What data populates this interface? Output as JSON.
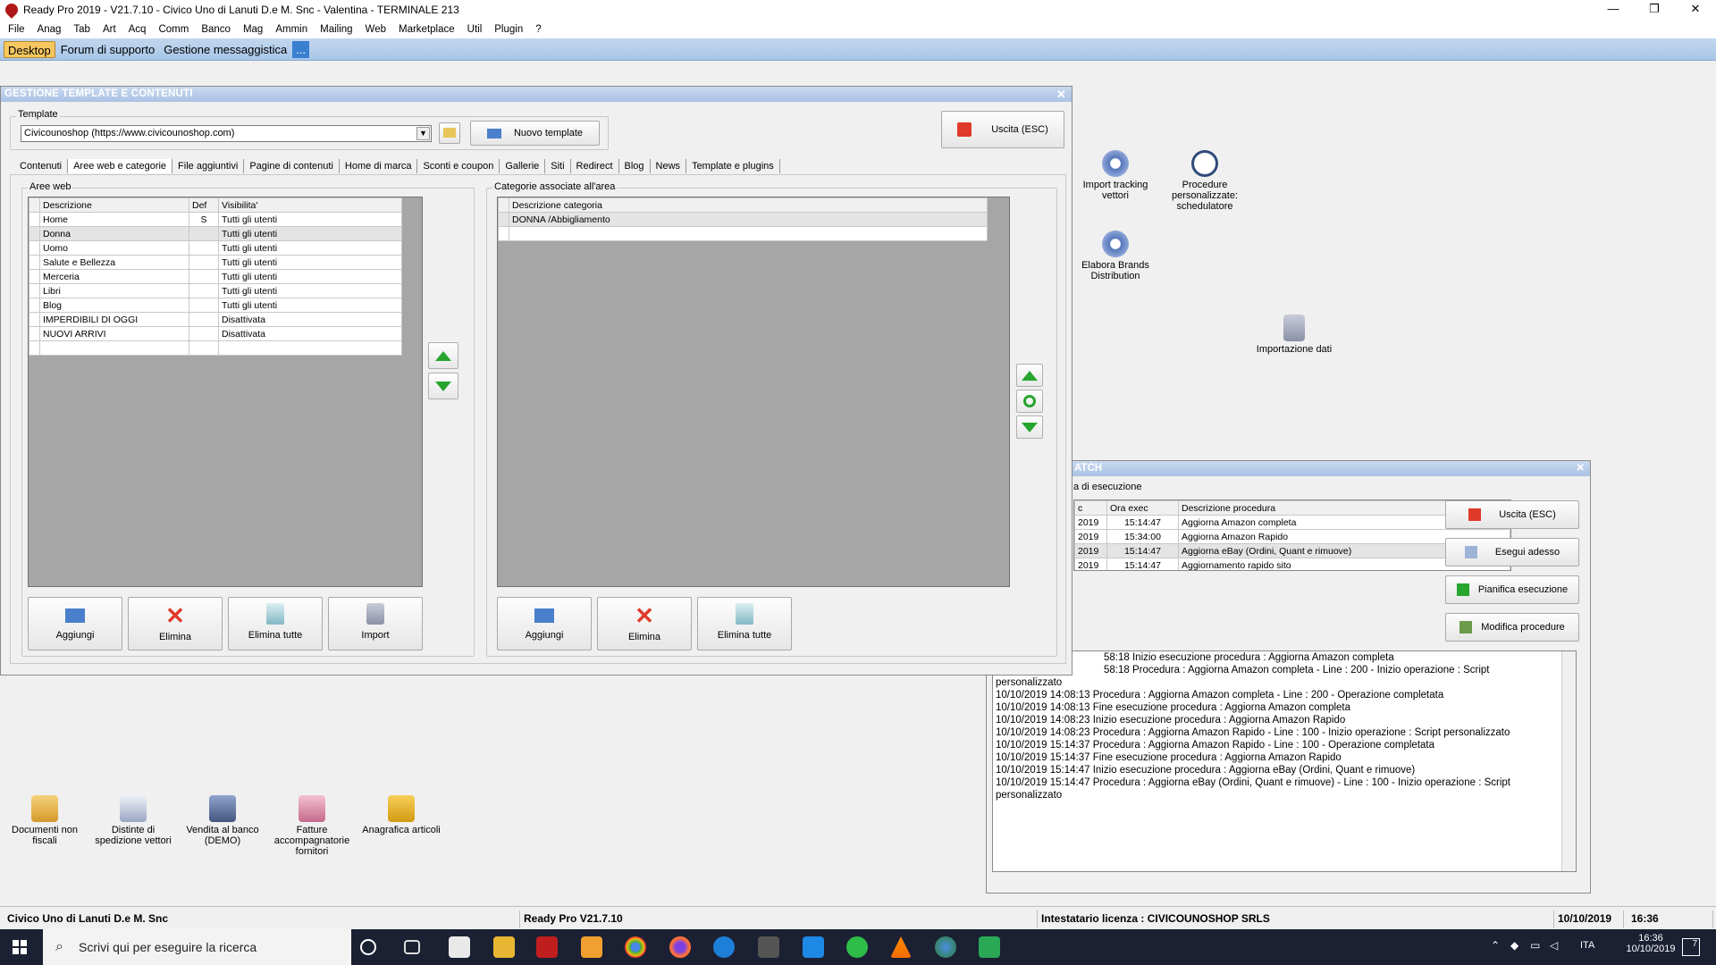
{
  "window": {
    "title": "Ready Pro 2019 - V21.7.10 - Civico Uno di Lanuti D.e M. Snc - Valentina - TERMINALE 213",
    "min": "—",
    "max": "❐",
    "close": "✕"
  },
  "menu": [
    "File",
    "Anag",
    "Tab",
    "Art",
    "Acq",
    "Comm",
    "Banco",
    "Mag",
    "Ammin",
    "Mailing",
    "Web",
    "Marketplace",
    "Util",
    "Plugin",
    "?"
  ],
  "tabs": [
    "Desktop",
    "Forum di supporto",
    "Gestione messaggistica",
    "..."
  ],
  "desktop_icons": {
    "import_tracking": "Import tracking vettori",
    "procedure": "Procedure personalizzate: schedulatore",
    "elabora": "Elabora Brands Distribution",
    "importazione": "Importazione dati",
    "documenti": "Documenti non fiscali",
    "distinte": "Distinte di spedizione vettori",
    "vendita": "Vendita al banco (DEMO)",
    "fatture": "Fatture accompagnatorie fornitori",
    "anagrafica": "Anagrafica articoli"
  },
  "dialog": {
    "title": "GESTIONE TEMPLATE E CONTENUTI",
    "close": "✕",
    "template_legend": "Template",
    "template_value": "Civicounoshop (https://www.civicounoshop.com)",
    "new_template": "Nuovo template",
    "exit": "Uscita (ESC)",
    "inner_tabs": [
      "Contenuti",
      "Aree web e categorie",
      "File aggiuntivi",
      "Pagine di contenuti",
      "Home di marca",
      "Sconti e coupon",
      "Gallerie",
      "Siti",
      "Redirect",
      "Blog",
      "News",
      "Template e plugins"
    ],
    "areas_legend": "Aree web",
    "areas_headers": [
      "Descrizione",
      "Def",
      "Visibilita'"
    ],
    "areas_rows": [
      [
        "Home",
        "S",
        "Tutti gli utenti"
      ],
      [
        "Donna",
        "",
        "Tutti gli utenti"
      ],
      [
        "Uomo",
        "",
        "Tutti gli utenti"
      ],
      [
        "Salute e Bellezza",
        "",
        "Tutti gli utenti"
      ],
      [
        "Merceria",
        "",
        "Tutti gli utenti"
      ],
      [
        "Libri",
        "",
        "Tutti gli utenti"
      ],
      [
        "Blog",
        "",
        "Tutti gli utenti"
      ],
      [
        "IMPERDIBILI DI OGGI",
        "",
        "Disattivata"
      ],
      [
        "NUOVI ARRIVI",
        "",
        "Disattivata"
      ],
      [
        "",
        "",
        ""
      ]
    ],
    "cat_legend": "Categorie associate all'area",
    "cat_header": "Descrizione categoria",
    "cat_rows": [
      "DONNA /Abbigliamento",
      ""
    ],
    "btn_add": "Aggiungi",
    "btn_del": "Elimina",
    "btn_del_all": "Elimina tutte",
    "btn_import": "Import"
  },
  "batch": {
    "title": "ATCH",
    "close": "✕",
    "subtitle": "a di esecuzione",
    "headers": [
      "c",
      "Ora exec",
      "Descrizione procedura"
    ],
    "rows": [
      [
        "2019",
        "15:14:47",
        "Aggiorna Amazon completa"
      ],
      [
        "2019",
        "15:34:00",
        "Aggiorna Amazon Rapido"
      ],
      [
        "2019",
        "15:14:47",
        "Aggiorna eBay  (Ordini, Quant e rimuove)"
      ],
      [
        "2019",
        "15:14:47",
        "Aggiornamento rapido sito"
      ],
      [
        "",
        "",
        ""
      ]
    ],
    "btn_exit": "Uscita (ESC)",
    "btn_run": "Esegui adesso",
    "btn_plan": "Pianifica esecuzione",
    "btn_edit": "Modifica procedure",
    "log": [
      "58:18 Inizio esecuzione procedura : Aggiorna Amazon completa",
      "58:18 Procedura : Aggiorna Amazon completa - Line : 200 - Inizio operazione : Script",
      "personalizzato",
      "10/10/2019 14:08:13 Procedura : Aggiorna Amazon completa - Line : 200 - Operazione completata",
      "10/10/2019 14:08:13 Fine esecuzione procedura : Aggiorna Amazon completa",
      "10/10/2019 14:08:23 Inizio esecuzione procedura : Aggiorna Amazon Rapido",
      "10/10/2019 14:08:23 Procedura : Aggiorna Amazon Rapido - Line : 100 - Inizio operazione : Script personalizzato",
      "10/10/2019 15:14:37 Procedura : Aggiorna Amazon Rapido - Line : 100 - Operazione completata",
      "10/10/2019 15:14:37 Fine esecuzione procedura : Aggiorna Amazon Rapido",
      "10/10/2019 15:14:47 Inizio esecuzione procedura : Aggiorna eBay  (Ordini, Quant e rimuove)",
      "10/10/2019 15:14:47 Procedura : Aggiorna eBay  (Ordini, Quant e rimuove) - Line : 100 - Inizio operazione : Script",
      "personalizzato"
    ]
  },
  "status": {
    "company": "Civico Uno di Lanuti D.e M. Snc",
    "version": "Ready Pro V21.7.10",
    "license": "Intestatario licenza : CIVICOUNOSHOP SRLS",
    "date": "10/10/2019",
    "time": "16:36"
  },
  "taskbar": {
    "search": "Scrivi qui per eseguire la ricerca",
    "lang": "ITA",
    "time": "16:36",
    "date": "10/10/2019",
    "notif": "7"
  },
  "colors": {
    "accent": "#f6c760",
    "titlebar": "#a9c2e4",
    "green": "#27a52e",
    "red": "#e03a2a"
  }
}
